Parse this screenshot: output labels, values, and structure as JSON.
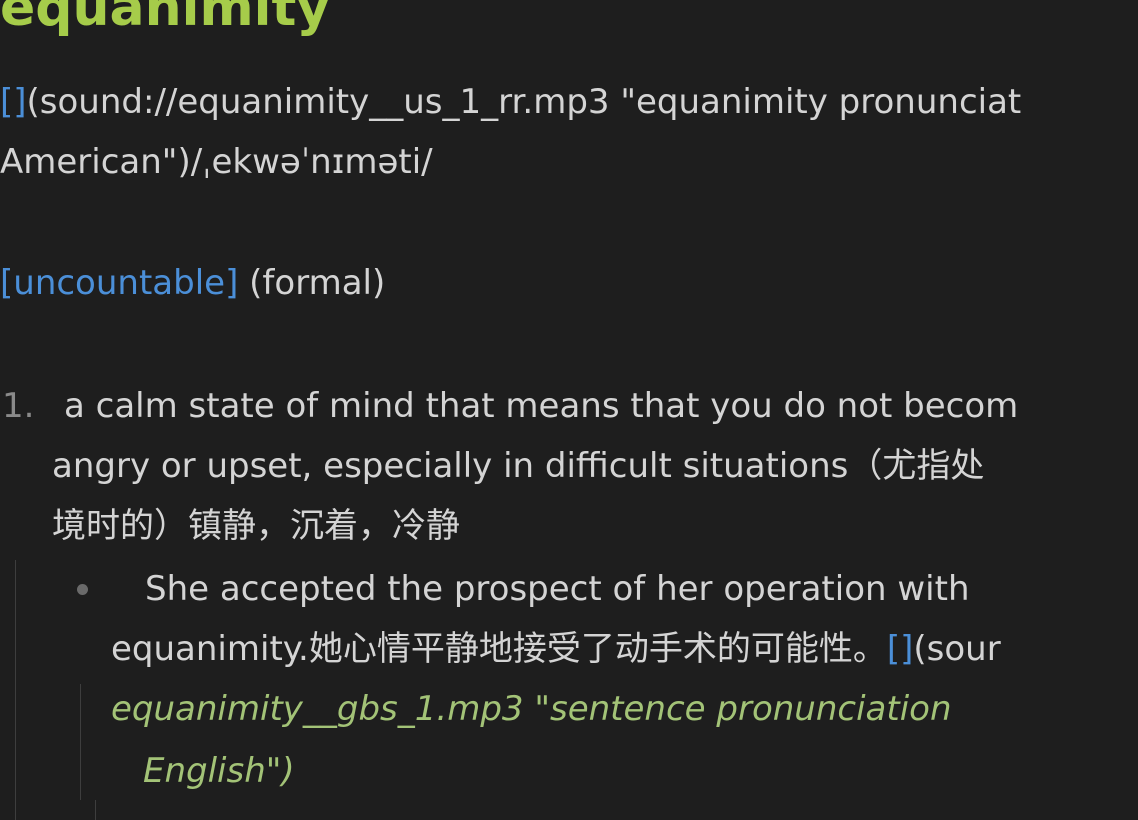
{
  "word": "equanimity",
  "pron": {
    "link_brackets": "[]",
    "line1_text": "(sound://equanimity__us_1_rr.mp3 \"equanimity pronunciat",
    "line2_text": "American\")/ˌekwəˈnɪməti/"
  },
  "grammar": {
    "tag": "[uncountable]",
    "register": "(formal)"
  },
  "definitions": [
    {
      "number": "1.",
      "line1": "a calm state of mind that means that you do not becom",
      "line2": "angry or upset, especially in difficult situations（尤指处",
      "line3": "境时的）镇静，沉着，冷静",
      "example": {
        "line1": "She accepted the prospect of her operation with",
        "line2_text": "equanimity.她心情平静地接受了动手术的可能性。",
        "line2_link": "[]",
        "line2_tail": "(sour",
        "line3": "equanimity__gbs_1.mp3 \"sentence pronunciation",
        "line4": "English\")"
      }
    }
  ]
}
